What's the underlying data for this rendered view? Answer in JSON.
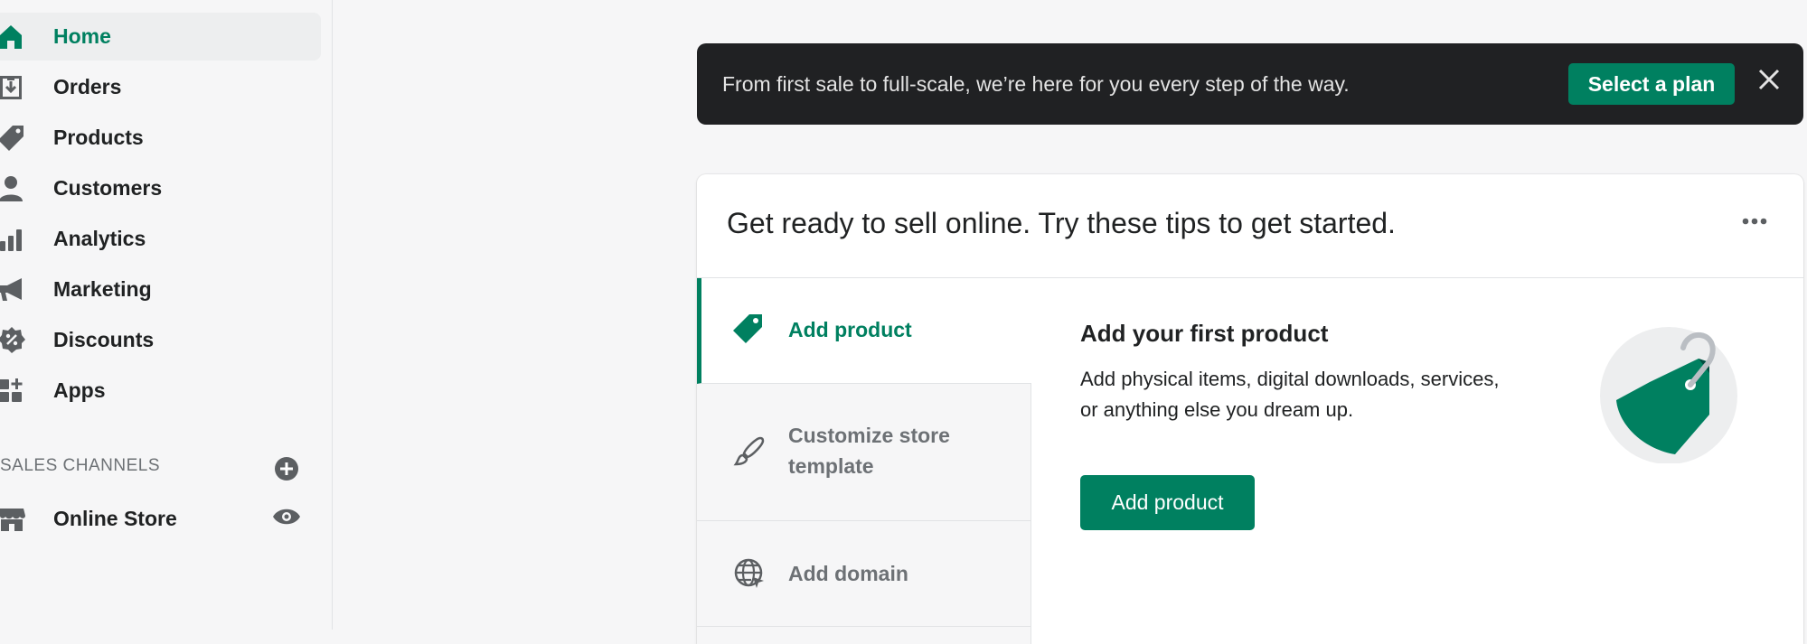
{
  "sidebar": {
    "items": [
      {
        "label": "Home",
        "icon": "home-icon",
        "active": true
      },
      {
        "label": "Orders",
        "icon": "orders-icon"
      },
      {
        "label": "Products",
        "icon": "tag-icon"
      },
      {
        "label": "Customers",
        "icon": "person-icon"
      },
      {
        "label": "Analytics",
        "icon": "bar-chart-icon"
      },
      {
        "label": "Marketing",
        "icon": "megaphone-icon"
      },
      {
        "label": "Discounts",
        "icon": "discount-icon"
      },
      {
        "label": "Apps",
        "icon": "apps-icon"
      }
    ],
    "sales_channels": {
      "heading": "SALES CHANNELS",
      "items": [
        {
          "label": "Online Store",
          "icon": "store-icon"
        }
      ]
    }
  },
  "banner": {
    "text": "From first sale to full-scale, we’re here for you every step of the way.",
    "button_label": "Select a plan"
  },
  "card": {
    "title": "Get ready to sell online. Try these tips to get started.",
    "tabs": [
      {
        "label": "Add product",
        "active": true
      },
      {
        "label_line1": "Customize store",
        "label_line2": "template"
      },
      {
        "label": "Add domain"
      }
    ],
    "content": {
      "title": "Add your first product",
      "description": "Add physical items, digital downloads, services, or anything else you dream up.",
      "button_label": "Add product"
    }
  },
  "colors": {
    "accent": "#008060",
    "banner_bg": "#202123",
    "sidebar_bg": "#f6f6f7"
  }
}
